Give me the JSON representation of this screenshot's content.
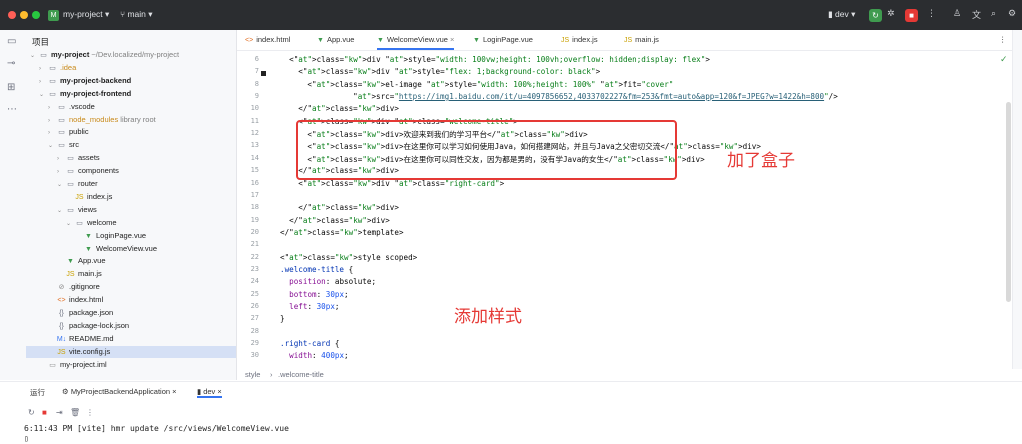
{
  "titlebar": {
    "project_badge": "M",
    "project_name": "my-project",
    "branch": "main",
    "run_config": "dev",
    "colors": {
      "traffic_red": "#ff5f57",
      "traffic_yellow": "#febc2e",
      "traffic_green": "#28c840",
      "run_green": "#3f9b4f",
      "stop_red": "#e53935"
    }
  },
  "project_panel": {
    "title": "项目",
    "tree": [
      {
        "label": "my-project",
        "suffix": "~/Dev.localized/my-project",
        "depth": 0,
        "expanded": true,
        "icon": "folder",
        "bold": true
      },
      {
        "label": ".idea",
        "depth": 1,
        "expanded": false,
        "icon": "folder"
      },
      {
        "label": "my-project-backend",
        "depth": 1,
        "expanded": false,
        "icon": "folder",
        "bold": true
      },
      {
        "label": "my-project-frontend",
        "depth": 1,
        "expanded": true,
        "icon": "folder",
        "bold": true
      },
      {
        "label": ".vscode",
        "depth": 2,
        "expanded": false,
        "icon": "folder"
      },
      {
        "label": "node_modules",
        "suffix": "library root",
        "depth": 2,
        "expanded": false,
        "icon": "folder"
      },
      {
        "label": "public",
        "depth": 2,
        "expanded": false,
        "icon": "folder"
      },
      {
        "label": "src",
        "depth": 2,
        "expanded": true,
        "icon": "folder"
      },
      {
        "label": "assets",
        "depth": 3,
        "expanded": false,
        "icon": "folder"
      },
      {
        "label": "components",
        "depth": 3,
        "expanded": false,
        "icon": "folder"
      },
      {
        "label": "router",
        "depth": 3,
        "expanded": true,
        "icon": "folder"
      },
      {
        "label": "index.js",
        "depth": 4,
        "icon": "js"
      },
      {
        "label": "views",
        "depth": 3,
        "expanded": true,
        "icon": "folder"
      },
      {
        "label": "welcome",
        "depth": 4,
        "expanded": true,
        "icon": "folder"
      },
      {
        "label": "LoginPage.vue",
        "depth": 5,
        "icon": "vue"
      },
      {
        "label": "WelcomeView.vue",
        "depth": 5,
        "icon": "vue"
      },
      {
        "label": "App.vue",
        "depth": 3,
        "icon": "vue"
      },
      {
        "label": "main.js",
        "depth": 3,
        "icon": "js"
      },
      {
        "label": ".gitignore",
        "depth": 2,
        "icon": "ignore"
      },
      {
        "label": "index.html",
        "depth": 2,
        "icon": "html"
      },
      {
        "label": "package.json",
        "depth": 2,
        "icon": "json"
      },
      {
        "label": "package-lock.json",
        "depth": 2,
        "icon": "json"
      },
      {
        "label": "README.md",
        "depth": 2,
        "icon": "md"
      },
      {
        "label": "vite.config.js",
        "depth": 2,
        "icon": "js",
        "selected": true
      },
      {
        "label": "my-project.iml",
        "depth": 1,
        "icon": "iml"
      }
    ]
  },
  "tabs": [
    {
      "label": "index.html",
      "icon": "html"
    },
    {
      "label": "App.vue",
      "icon": "vue"
    },
    {
      "label": "WelcomeView.vue",
      "icon": "vue",
      "active": true
    },
    {
      "label": "LoginPage.vue",
      "icon": "vue"
    },
    {
      "label": "index.js",
      "icon": "js"
    },
    {
      "label": "main.js",
      "icon": "js"
    }
  ],
  "editor": {
    "lines": [
      {
        "n": "6",
        "text": "  <div style=\"width: 100vw;height: 100vh;overflow: hidden;display: flex\">"
      },
      {
        "n": "7",
        "text": "    <div style=\"flex: 1;background-color: black\">"
      },
      {
        "n": "8",
        "text": "      <el-image style=\"width: 100%;height: 100%\" fit=\"cover\""
      },
      {
        "n": "9",
        "text": "                src=\"https://img1.baidu.com/it/u=4097856652,4033702227&fm=253&fmt=auto&app=120&f=JPEG?w=1422&h=800\"/>"
      },
      {
        "n": "10",
        "text": "    </div>"
      },
      {
        "n": "11",
        "text": "    <div class=\"welcome-title\">"
      },
      {
        "n": "12",
        "text": "      <div>欢迎来到我们的学习平台</div>"
      },
      {
        "n": "13",
        "text": "      <div>在这里你可以学习如何使用Java，如何搭建网站，并且与Java之父密切交流</div>"
      },
      {
        "n": "14",
        "text": "      <div>在这里你可以同性交友，因为都是男的，没有学Java的女生</div>"
      },
      {
        "n": "15",
        "text": "    </div>"
      },
      {
        "n": "16",
        "text": "    <div class=\"right-card\">"
      },
      {
        "n": "17",
        "text": ""
      },
      {
        "n": "18",
        "text": "    </div>"
      },
      {
        "n": "19",
        "text": "  </div>"
      },
      {
        "n": "20",
        "text": "</template>"
      },
      {
        "n": "21",
        "text": ""
      },
      {
        "n": "22",
        "text": "<style scoped>"
      },
      {
        "n": "23",
        "text": ".welcome-title {"
      },
      {
        "n": "24",
        "text": "  position: absolute;"
      },
      {
        "n": "25",
        "text": "  bottom: 30px;"
      },
      {
        "n": "26",
        "text": "  left: 30px;"
      },
      {
        "n": "27",
        "text": "}"
      },
      {
        "n": "28",
        "text": ""
      },
      {
        "n": "29",
        "text": ".right-card {"
      },
      {
        "n": "30",
        "text": "  width: 400px;"
      }
    ],
    "annotation_box": "加了盒子",
    "annotation_style": "添加样式",
    "breadcrumb": [
      "style",
      ".welcome-title"
    ]
  },
  "run_panel": {
    "label": "运行",
    "tabs": [
      "MyProjectBackendApplication",
      "dev"
    ],
    "log_line": "6:11:43 PM [vite] hmr update /src/views/WelcomeView.vue"
  }
}
